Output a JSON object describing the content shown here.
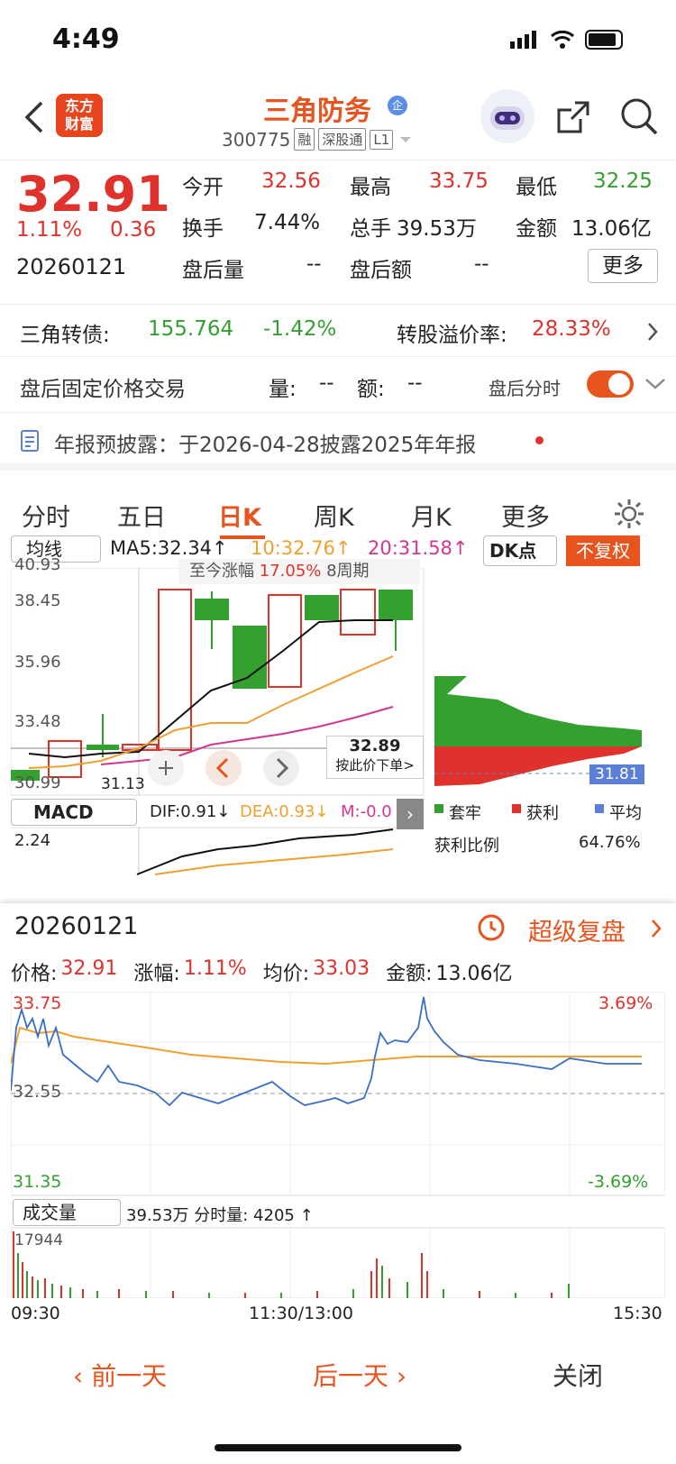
{
  "status": {
    "time": "4:49"
  },
  "header": {
    "logo": "东方\n财富",
    "name": "三角防务",
    "badge": "企",
    "code": "300775",
    "tags": [
      "融",
      "深股通",
      "L1"
    ]
  },
  "quote": {
    "price": "32.91",
    "pct": "1.11%",
    "chg": "0.36",
    "date": "20260121",
    "open_l": "今开",
    "open": "32.56",
    "high_l": "最高",
    "high": "33.75",
    "low_l": "最低",
    "low": "32.25",
    "turn_l": "换手",
    "turn": "7.44%",
    "vol_l": "总手",
    "vol": "39.53万",
    "amt_l": "金额",
    "amt": "13.06亿",
    "ahv_l": "盘后量",
    "ahv": "--",
    "aha_l": "盘后额",
    "aha": "--",
    "more": "更多"
  },
  "bond": {
    "label": "三角转债:",
    "price": "155.764",
    "chg": "-1.42%",
    "prem_l": "转股溢价率:",
    "prem": "28.33%"
  },
  "fixed": {
    "label": "盘后固定价格交易",
    "vol_l": "量:",
    "vol": "--",
    "amt_l": "额:",
    "amt": "--",
    "time_l": "盘后分时"
  },
  "notice": "年报预披露：于2026-04-28披露2025年年报",
  "tabs": [
    "分时",
    "五日",
    "日K",
    "周K",
    "月K",
    "更多"
  ],
  "kline": {
    "ind": "均线",
    "ma5": "MA5:32.34↑",
    "ma10": "10:32.76↑",
    "ma20": "20:31.58↑",
    "dk": "DK点",
    "fq": "不复权",
    "y": [
      "40.93",
      "38.45",
      "35.96",
      "33.48",
      "30.99"
    ],
    "low_mark": "31.13",
    "tip": "至今涨幅",
    "tip_v": "17.05%",
    "tip_p": "8周期",
    "cross_v": "32.89",
    "cross_t": "按此价下单>",
    "avg": "31.81",
    "legend": [
      "套牢",
      "获利",
      "平均"
    ],
    "profit_l": "获利比例",
    "profit": "64.76%",
    "macd": "MACD",
    "dif": "DIF:0.91↓",
    "dea": "DEA:0.93↓",
    "m": "M:-0.0",
    "macd_y": "2.24"
  },
  "detail": {
    "date": "20260121",
    "replay": "超级复盘",
    "price_l": "价格:",
    "price": "32.91",
    "pct_l": "涨幅:",
    "pct": "1.11%",
    "avg_l": "均价:",
    "avg": "33.03",
    "amt_l": "金额:",
    "amt": "13.06亿",
    "y_top": "33.75",
    "y_mid": "32.55",
    "y_bot": "31.35",
    "pct_top": "3.69%",
    "pct_bot": "-3.69%",
    "vol_sel": "成交量",
    "vol_info": "39.53万 分时量: 4205 ↑",
    "vol_max": "17944",
    "t0": "09:30",
    "t1": "11:30/13:00",
    "t2": "15:30"
  },
  "bottom": {
    "prev": "前一天",
    "next": "后一天",
    "close": "关闭"
  },
  "colors": {
    "up": "#e0322d",
    "down": "#34a030",
    "brand": "#e8541e"
  }
}
